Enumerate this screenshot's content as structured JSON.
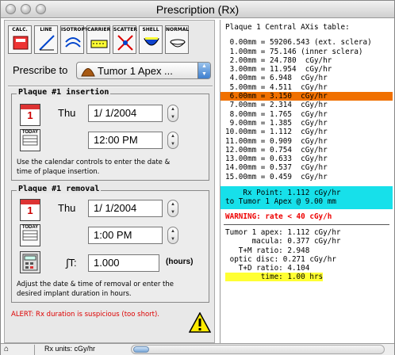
{
  "window": {
    "title": "Prescription (Rx)"
  },
  "toolbar": {
    "tools": [
      {
        "label": "CALC.",
        "icon": "calc-icon"
      },
      {
        "label": "LINE",
        "icon": "line-icon"
      },
      {
        "label": "ISOTROPY",
        "icon": "isotropy-icon"
      },
      {
        "label": "CARRIER",
        "icon": "carrier-icon"
      },
      {
        "label": "SCATTER",
        "icon": "scatter-icon"
      },
      {
        "label": "SHELL",
        "icon": "shell-icon"
      },
      {
        "label": "NORMAL",
        "icon": "normal-icon"
      }
    ]
  },
  "prescribe": {
    "label": "Prescribe to",
    "value": "Tumor 1 Apex ..."
  },
  "insertion": {
    "title": "Plaque #1 insertion",
    "cal_num": "1",
    "today": "TODAY",
    "day": "Thu",
    "date": "1/  1/2004",
    "time": "12:00 PM",
    "note_line1": "Use the calendar controls to enter the date &",
    "note_line2": "time of plaque insertion."
  },
  "removal": {
    "title": "Plaque #1 removal",
    "cal_num": "1",
    "today": "TODAY",
    "day": "Thu",
    "date": "1/  1/2004",
    "time": "1:00 PM",
    "dt_label": "∫T:",
    "dt_value": "1.000",
    "dt_unit": "(hours)",
    "note_line1": "Adjust the date & time of removal or enter the",
    "note_line2": "desired implant duration in hours."
  },
  "alert": "ALERT: Rx duration is suspicious (too short).",
  "table": {
    "heading": "Plaque 1 Central AXis table:",
    "rows": [
      " 0.00mm = 59206.543 (ext. sclera)",
      " 1.00mm = 75.146 (inner sclera)",
      " 2.00mm = 24.780  cGy/hr",
      " 3.00mm = 11.954  cGy/hr",
      " 4.00mm = 6.948  cGy/hr",
      " 5.00mm = 4.511  cGy/hr",
      " 6.00mm = 3.150  cGy/hr",
      " 7.00mm = 2.314  cGy/hr",
      " 8.00mm = 1.765  cGy/hr",
      " 9.00mm = 1.385  cGy/hr",
      "10.00mm = 1.112  cGy/hr",
      "11.00mm = 0.909  cGy/hr",
      "12.00mm = 0.754  cGy/hr",
      "13.00mm = 0.633  cGy/hr",
      "14.00mm = 0.537  cGy/hr",
      "15.00mm = 0.459  cGy/hr"
    ],
    "highlight_index": 6
  },
  "rx_point": {
    "line1": "    Rx Point: 1.112 cGy/hr",
    "line2": "to Tumor 1 Apex @ 9.00 mm"
  },
  "warning": "WARNING: rate < 40 cGy/h",
  "summary": [
    "Tumor 1 apex: 1.112 cGy/hr",
    "      macula: 0.377 cGy/hr",
    "   T+M ratio: 2.948",
    " optic disc: 0.271 cGy/hr",
    "   T+D ratio: 4.104"
  ],
  "time_line": {
    "label": "        time:",
    "value": " 1.00 hrs"
  },
  "status": {
    "units": "Rx units: cGy/hr"
  },
  "colors": {
    "highlight": "#f07000",
    "rx_bg": "#17e0ea",
    "time_bg": "#ffff33",
    "alert": "#dd0000"
  }
}
